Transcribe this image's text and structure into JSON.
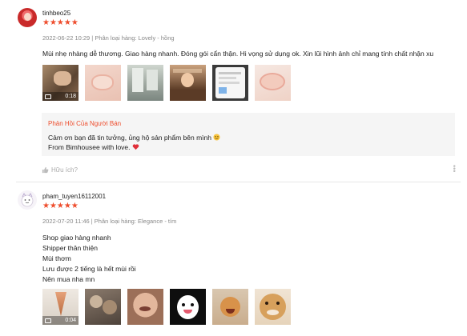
{
  "reviews": [
    {
      "username": "tinhbeo25",
      "stars": "★★★★★",
      "rating": 5,
      "meta": "2022-06-22 10:29 | Phân loại hàng: Lovely - hồng",
      "comment": "Mùi nhẹ nhàng dễ thương. Giao hàng nhanh. Đóng gói cẩn thận. Hi vọng sử dụng ok. Xin lũi hình ảnh chỉ mang tính chất nhận xu",
      "video_duration": "0:18",
      "seller_reply": {
        "title": "Phản Hồi Của Người Bán",
        "line1": "Cảm ơn bạn đã tin tưởng, ủng hộ sản phẩm bên mình",
        "line2": "From Bimhousee with love."
      },
      "helpful_label": "Hữu ích?"
    },
    {
      "username": "pham_tuyen16112001",
      "stars": "★★★★★",
      "rating": 5,
      "meta": "2022-07-20 11:46 | Phân loại hàng: Elegance - tím",
      "comment_lines": [
        "Shop giao hàng nhanh",
        "Shipper thân thiện",
        "Mùi thơm",
        "Lưu được 2 tiếng là hết mùi rồi",
        "Nên mua nha mn"
      ],
      "video_duration": "0:04"
    }
  ],
  "colors": {
    "accent": "#ee4d2d",
    "reply_bg": "#f5f5f5"
  }
}
